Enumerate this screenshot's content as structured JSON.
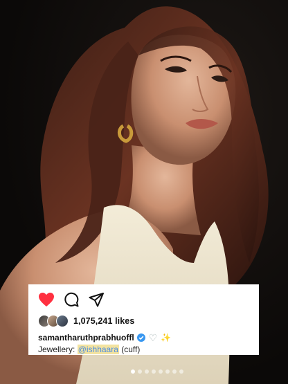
{
  "post": {
    "likes": "1,075,241 likes",
    "username": "samantharuthprabhuoffl",
    "caption_prefix": "Jewellery: ",
    "mention": "@ishhaara",
    "caption_suffix": " (cuff)",
    "emoji_heart": "♡",
    "emoji_sparkle": "✨"
  },
  "carousel": {
    "total": 8,
    "active_index": 0
  },
  "colors": {
    "like_red": "#ff3040",
    "verified_blue": "#3897f0",
    "mention_highlight": "#f3e3a0"
  },
  "icons": [
    "heart-filled-icon",
    "comment-icon",
    "share-icon",
    "verified-badge-icon"
  ]
}
